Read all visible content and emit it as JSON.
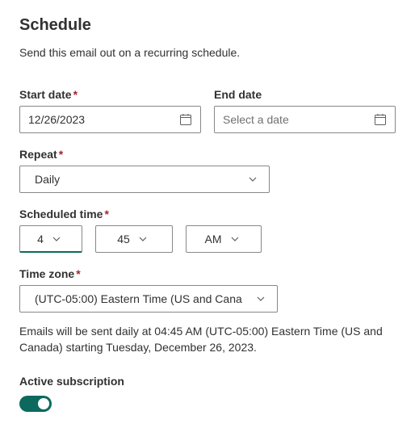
{
  "title": "Schedule",
  "subtitle": "Send this email out on a recurring schedule.",
  "startDate": {
    "label": "Start date",
    "required": true,
    "value": "12/26/2023"
  },
  "endDate": {
    "label": "End date",
    "required": false,
    "placeholder": "Select a date"
  },
  "repeat": {
    "label": "Repeat",
    "required": true,
    "value": "Daily"
  },
  "scheduledTime": {
    "label": "Scheduled time",
    "required": true,
    "hour": "4",
    "minute": "45",
    "ampm": "AM"
  },
  "timeZone": {
    "label": "Time zone",
    "required": true,
    "value": "(UTC-05:00) Eastern Time (US and Cana"
  },
  "summary": "Emails will be sent daily at 04:45 AM (UTC-05:00) Eastern Time (US and Canada) starting Tuesday, December 26, 2023.",
  "subscription": {
    "label": "Active subscription",
    "active": true
  }
}
